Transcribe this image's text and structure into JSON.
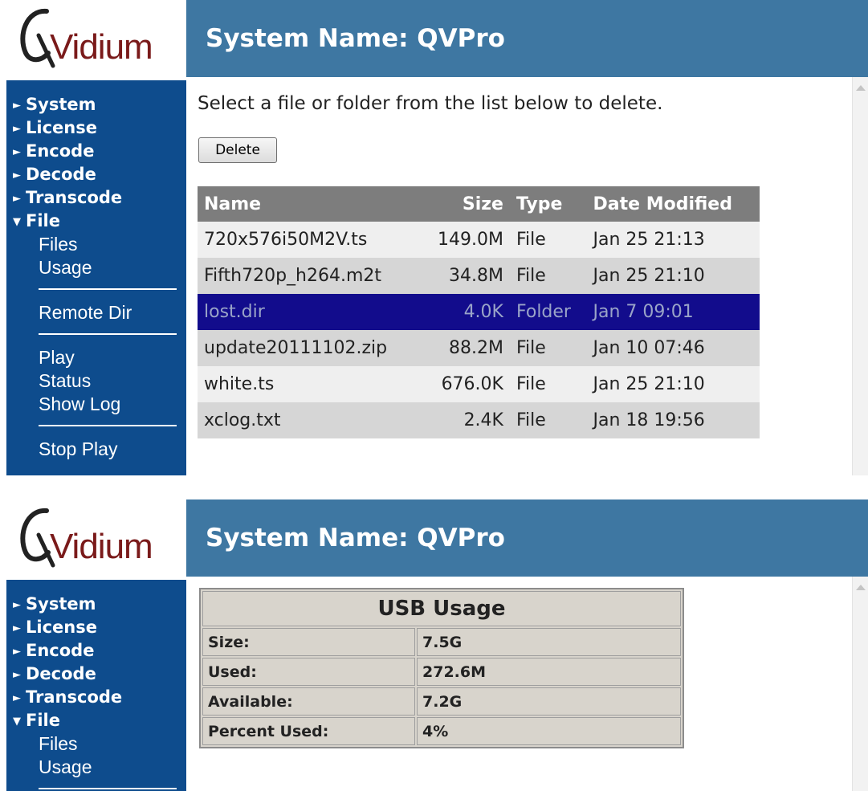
{
  "brand": {
    "logo_text": "Vidium"
  },
  "header": {
    "title": "System Name: QVPro"
  },
  "nav": {
    "arrow_collapsed": "►",
    "arrow_expanded": "▼",
    "sections": [
      "System",
      "License",
      "Encode",
      "Decode",
      "Transcode",
      "File"
    ],
    "file_sub": [
      "Files",
      "Usage"
    ],
    "remote": "Remote Dir",
    "play_group": [
      "Play",
      "Status",
      "Show Log"
    ],
    "stop": "Stop Play"
  },
  "files_page": {
    "instruction": "Select a file or folder from the list below to delete.",
    "delete_label": "Delete",
    "columns": [
      "Name",
      "Size",
      "Type",
      "Date Modified"
    ],
    "rows": [
      [
        "720x576i50M2V.ts",
        "149.0M",
        "File",
        "Jan 25 21:13"
      ],
      [
        "Fifth720p_h264.m2t",
        "34.8M",
        "File",
        "Jan 25 21:10"
      ],
      [
        "lost.dir",
        "4.0K",
        "Folder",
        "Jan 7 09:01"
      ],
      [
        "update20111102.zip",
        "88.2M",
        "File",
        "Jan 10 07:46"
      ],
      [
        "white.ts",
        "676.0K",
        "File",
        "Jan 25 21:10"
      ],
      [
        "xclog.txt",
        "2.4K",
        "File",
        "Jan 18 19:56"
      ]
    ],
    "selected_row": 2
  },
  "usage_page": {
    "title": "USB Usage",
    "rows": [
      [
        "Size:",
        "7.5G"
      ],
      [
        "Used:",
        "272.6M"
      ],
      [
        "Available:",
        "7.2G"
      ],
      [
        "Percent Used:",
        "4%"
      ]
    ]
  },
  "colors": {
    "header": "#3e77a2",
    "sidebar": "#0e4c8d",
    "logo_text": "#7a1a1a",
    "table_header": "#7d7d7d",
    "row_selected": "#120c8c",
    "usage_bg": "#d8d4cc"
  }
}
